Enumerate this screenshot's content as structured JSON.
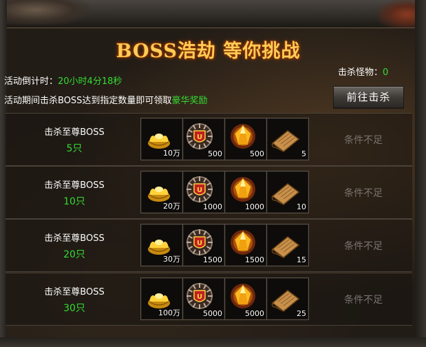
{
  "title": "BOSS浩劫 等你挑战",
  "countdown": {
    "label": "活动倒计时：",
    "value": "20小时4分18秒"
  },
  "kills": {
    "label": "击杀怪物：",
    "value": "0"
  },
  "desc": {
    "text": "活动期间击杀BOSS达到指定数量即可领取",
    "highlight": "豪华奖励"
  },
  "go_button": "前往击杀",
  "rows": [
    {
      "title": "击杀至尊BOSS",
      "count": "5只",
      "items": [
        "10万",
        "500",
        "500",
        "5"
      ],
      "status": "条件不足"
    },
    {
      "title": "击杀至尊BOSS",
      "count": "10只",
      "items": [
        "20万",
        "1000",
        "1000",
        "10"
      ],
      "status": "条件不足"
    },
    {
      "title": "击杀至尊BOSS",
      "count": "20只",
      "items": [
        "30万",
        "1500",
        "1500",
        "15"
      ],
      "status": "条件不足"
    },
    {
      "title": "击杀至尊BOSS",
      "count": "30只",
      "items": [
        "100万",
        "5000",
        "5000",
        "25"
      ],
      "status": "条件不足"
    }
  ],
  "item_icons": [
    "gold-ingot-icon",
    "shield-emblem-icon",
    "gem-crystal-icon",
    "scroll-icon"
  ]
}
